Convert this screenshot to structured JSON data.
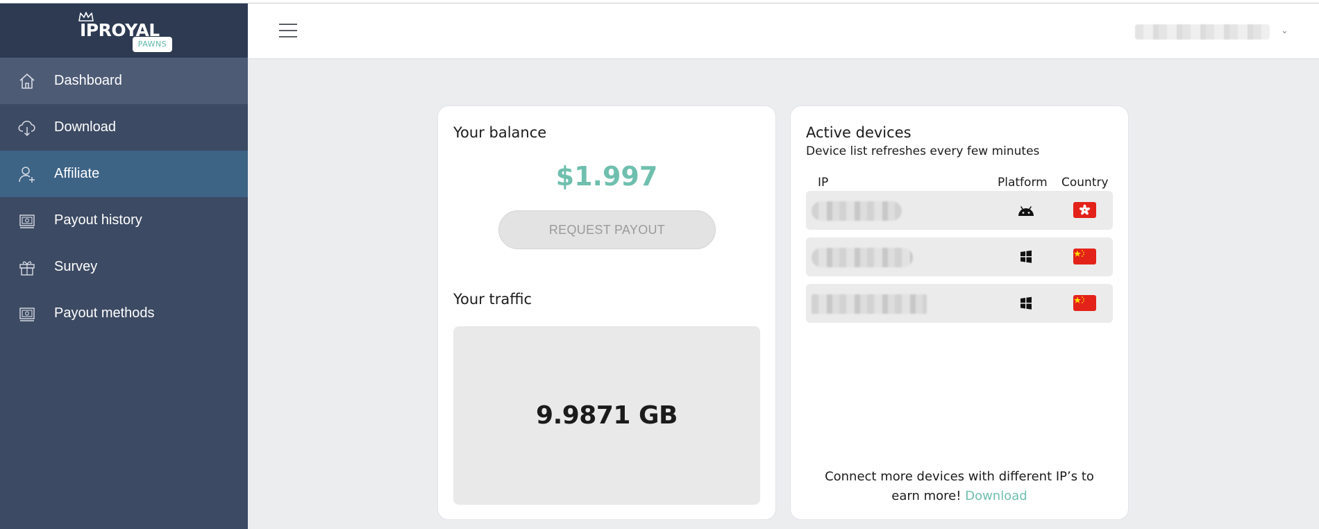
{
  "brand": {
    "name": "IPROYAL",
    "badge": "PAWNS"
  },
  "sidebar": {
    "items": [
      {
        "label": "Dashboard",
        "icon": "home-icon",
        "state": "hover"
      },
      {
        "label": "Download",
        "icon": "cloud-download-icon"
      },
      {
        "label": "Affiliate",
        "icon": "user-plus-icon",
        "state": "active"
      },
      {
        "label": "Payout history",
        "icon": "banknote-icon"
      },
      {
        "label": "Survey",
        "icon": "gift-icon"
      },
      {
        "label": "Payout methods",
        "icon": "banknote-icon"
      }
    ]
  },
  "header": {
    "menu_icon": "hamburger-icon"
  },
  "balance": {
    "title": "Your balance",
    "amount": "$1.997",
    "payout_button": "REQUEST PAYOUT",
    "traffic_title": "Your traffic",
    "traffic_value": "9.9871 GB"
  },
  "devices": {
    "title": "Active devices",
    "subtitle": "Device list refreshes every few minutes",
    "columns": [
      "IP",
      "Platform",
      "Country"
    ],
    "rows": [
      {
        "platform": "android-icon",
        "country": "hong-kong-flag-icon"
      },
      {
        "platform": "windows-icon",
        "country": "china-flag-icon"
      },
      {
        "platform": "windows-icon",
        "country": "china-flag-icon"
      }
    ],
    "connect_text": "Connect more devices with different IP’s to earn more!",
    "download_link": "Download"
  },
  "colors": {
    "sidebar_bg": "#3c4a63",
    "brand_bg": "#2d3a52",
    "active_item": "#3d6385",
    "accent": "#6fbfae",
    "page_bg": "#ecedef"
  }
}
